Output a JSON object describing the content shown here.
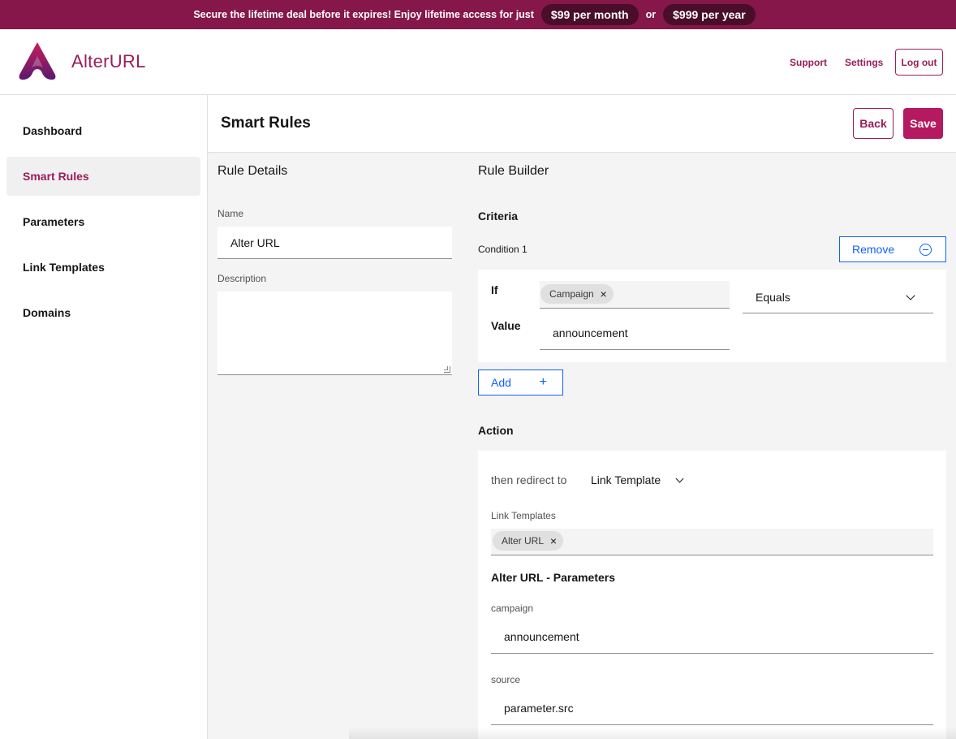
{
  "banner": {
    "message": "Secure the lifetime deal before it expires! Enjoy lifetime access for just",
    "monthly_price": "$99 per month",
    "or": "or",
    "yearly_price": "$999 per year"
  },
  "header": {
    "logo_text": "AlterURL",
    "support": "Support",
    "settings": "Settings",
    "logout": "Log out"
  },
  "sidebar": {
    "items": [
      {
        "label": "Dashboard",
        "active": false
      },
      {
        "label": "Smart Rules",
        "active": true
      },
      {
        "label": "Parameters",
        "active": false
      },
      {
        "label": "Link Templates",
        "active": false
      },
      {
        "label": "Domains",
        "active": false
      }
    ]
  },
  "page": {
    "title": "Smart Rules",
    "back": "Back",
    "save": "Save"
  },
  "rule_details": {
    "heading": "Rule Details",
    "name_label": "Name",
    "name_value": "Alter URL",
    "description_label": "Description",
    "description_value": ""
  },
  "rule_builder": {
    "heading": "Rule Builder",
    "criteria_heading": "Criteria",
    "condition_label": "Condition 1",
    "remove": "Remove",
    "if_label": "If",
    "if_tag": "Campaign",
    "operator": "Equals",
    "value_label": "Value",
    "value": "announcement",
    "add": "Add",
    "action_heading": "Action",
    "redirect_label": "then redirect to",
    "redirect_select": "Link Template",
    "link_templates_label": "Link Templates",
    "link_template_tag": "Alter URL",
    "params_heading": "Alter URL - Parameters",
    "campaign_label": "campaign",
    "campaign_value": "announcement",
    "source_label": "source",
    "source_value": "parameter.src"
  },
  "colors": {
    "brand": "#9b1d58",
    "banner": "#86174a",
    "save_button": "#b5195f",
    "link_blue": "#0f62fe"
  }
}
